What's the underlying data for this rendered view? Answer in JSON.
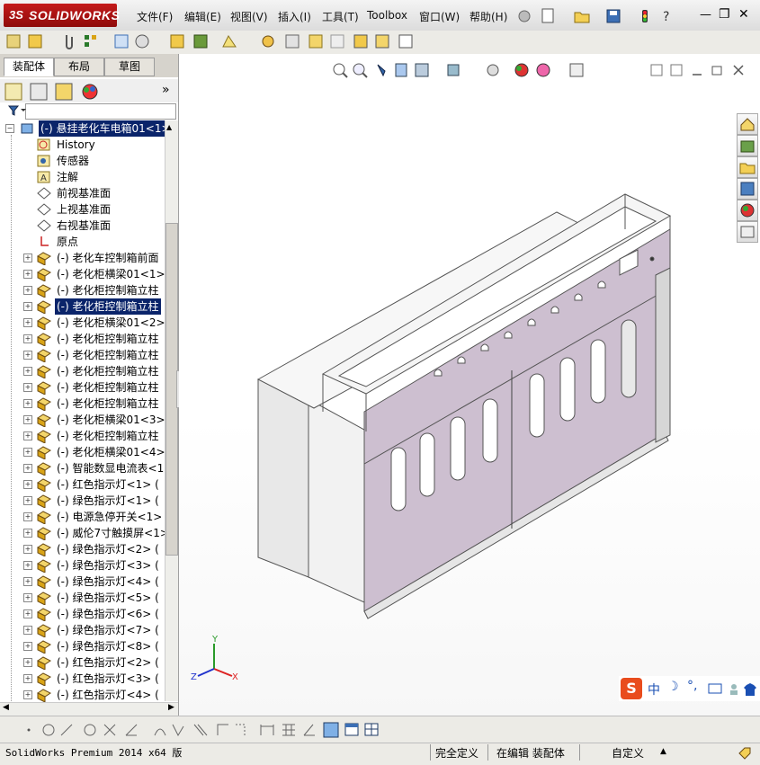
{
  "app": {
    "brand_prefix": "3S",
    "brand": "SOLIDWORKS"
  },
  "menu": [
    {
      "label": "文件(F)"
    },
    {
      "label": "编辑(E)"
    },
    {
      "label": "视图(V)"
    },
    {
      "label": "插入(I)"
    },
    {
      "label": "工具(T)"
    },
    {
      "label": "Toolbox"
    },
    {
      "label": "窗口(W)"
    },
    {
      "label": "帮助(H)"
    }
  ],
  "window_controls": {
    "minimize": "—",
    "restore": "❐",
    "close": "✕"
  },
  "tabs": [
    {
      "label": "装配体",
      "active": true
    },
    {
      "label": "布局",
      "active": false
    },
    {
      "label": "草图",
      "active": false
    }
  ],
  "panel": {
    "expand_glyph": "»"
  },
  "tree": {
    "root": "(-) 悬挂老化车电箱01<1>",
    "items": [
      {
        "label": "History",
        "icon": "history-icon"
      },
      {
        "label": "传感器",
        "icon": "sensor-icon"
      },
      {
        "label": "注解",
        "icon": "annotation-icon"
      },
      {
        "label": "前视基准面",
        "icon": "plane-icon"
      },
      {
        "label": "上视基准面",
        "icon": "plane-icon"
      },
      {
        "label": "右视基准面",
        "icon": "plane-icon"
      },
      {
        "label": "原点",
        "icon": "origin-icon"
      },
      {
        "label": "(-) 老化车控制箱前面",
        "icon": "part-icon"
      },
      {
        "label": "(-) 老化柜横梁01<1>",
        "icon": "part-icon"
      },
      {
        "label": "(-) 老化柜控制箱立柱",
        "icon": "part-icon"
      },
      {
        "label": "(-) 老化柜控制箱立柱",
        "icon": "part-icon",
        "selected": true
      },
      {
        "label": "(-) 老化柜横梁01<2>",
        "icon": "part-icon"
      },
      {
        "label": "(-) 老化柜控制箱立柱",
        "icon": "part-icon"
      },
      {
        "label": "(-) 老化柜控制箱立柱",
        "icon": "part-icon"
      },
      {
        "label": "(-) 老化柜控制箱立柱",
        "icon": "part-icon"
      },
      {
        "label": "(-) 老化柜控制箱立柱",
        "icon": "part-icon"
      },
      {
        "label": "(-) 老化柜控制箱立柱",
        "icon": "part-icon"
      },
      {
        "label": "(-) 老化柜横梁01<3>",
        "icon": "part-icon"
      },
      {
        "label": "(-) 老化柜控制箱立柱",
        "icon": "part-icon"
      },
      {
        "label": "(-) 老化柜横梁01<4>",
        "icon": "part-icon"
      },
      {
        "label": "(-) 智能数显电流表<1",
        "icon": "part-icon"
      },
      {
        "label": "(-) 红色指示灯<1> (",
        "icon": "part-icon"
      },
      {
        "label": "(-) 绿色指示灯<1> (",
        "icon": "part-icon"
      },
      {
        "label": "(-) 电源急停开关<1>",
        "icon": "part-icon"
      },
      {
        "label": "(-) 威伦7寸触摸屏<1>",
        "icon": "part-icon"
      },
      {
        "label": "(-) 绿色指示灯<2> (",
        "icon": "part-icon"
      },
      {
        "label": "(-) 绿色指示灯<3> (",
        "icon": "part-icon"
      },
      {
        "label": "(-) 绿色指示灯<4> (",
        "icon": "part-icon"
      },
      {
        "label": "(-) 绿色指示灯<5> (",
        "icon": "part-icon"
      },
      {
        "label": "(-) 绿色指示灯<6> (",
        "icon": "part-icon"
      },
      {
        "label": "(-) 绿色指示灯<7> (",
        "icon": "part-icon"
      },
      {
        "label": "(-) 绿色指示灯<8> (",
        "icon": "part-icon"
      },
      {
        "label": "(-) 红色指示灯<2> (",
        "icon": "part-icon"
      },
      {
        "label": "(-) 红色指示灯<3> (",
        "icon": "part-icon"
      },
      {
        "label": "(-) 红色指示灯<4> (",
        "icon": "part-icon"
      }
    ]
  },
  "triad": {
    "x": "X",
    "y": "Y",
    "z": "Z"
  },
  "ime": {
    "lang": "中",
    "moon": "☽",
    "punct": "°,"
  },
  "status": {
    "product": "SolidWorks Premium 2014 x64 版",
    "state": "完全定义",
    "mode": "在编辑 装配体",
    "units": "自定义"
  },
  "colors": {
    "accent": "#0a246a",
    "panel_fill": "#cdbfd0",
    "frame": "#e6e6e6"
  }
}
